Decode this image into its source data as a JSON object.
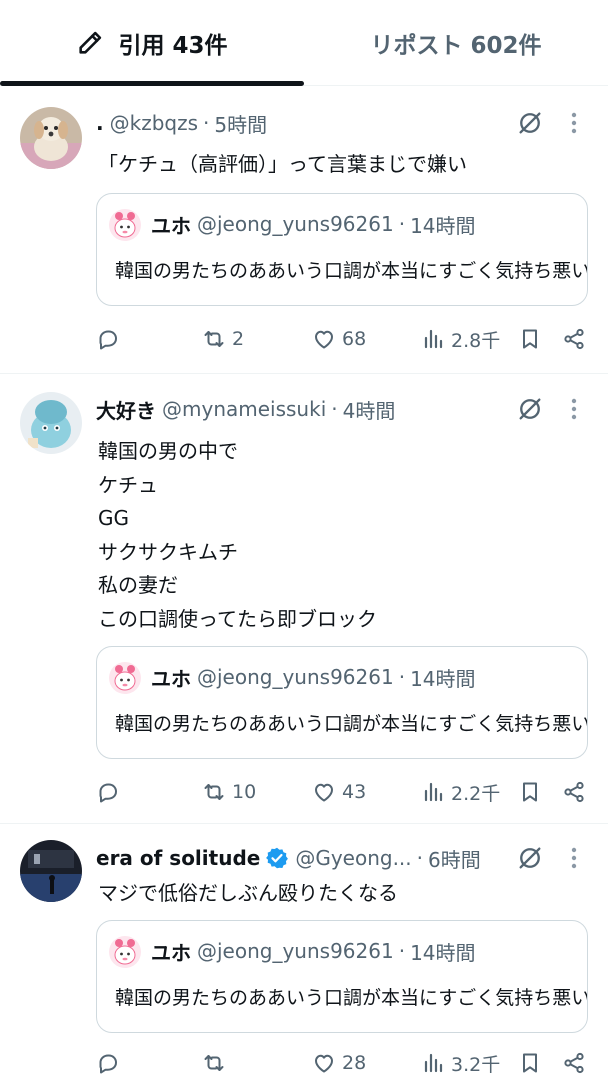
{
  "tabs": {
    "quotes_label": "引用 43件",
    "reposts_label": "リポスト 602件"
  },
  "colors": {
    "text": "#0f1419",
    "secondary": "#536471",
    "border": "#cfd9de",
    "verified": "#1d9bf0"
  },
  "tweets": [
    {
      "display_name": ".",
      "handle": "@kzbqzs",
      "separator": "·",
      "time": "5時間",
      "lines": [
        "「ケチュ（高評価）」って言葉まじで嫌い"
      ],
      "quote": {
        "display_name": "ユホ",
        "handle": "@jeong_yuns96261",
        "separator": "·",
        "time": "14時間",
        "text": "韓国の男たちのああいう口調が本当にすごく気持ち悪い..."
      },
      "reply_count": "",
      "repost_count": "2",
      "like_count": "68",
      "view_count": "2.8千"
    },
    {
      "display_name": "大好き",
      "handle": "@mynameissuki",
      "separator": "·",
      "time": "4時間",
      "lines": [
        "韓国の男の中で",
        "ケチュ",
        "GG",
        "サクサクキムチ",
        "私の妻だ",
        "この口調使ってたら即ブロック"
      ],
      "quote": {
        "display_name": "ユホ",
        "handle": "@jeong_yuns96261",
        "separator": "·",
        "time": "14時間",
        "text": "韓国の男たちのああいう口調が本当にすごく気持ち悪い..."
      },
      "reply_count": "",
      "repost_count": "10",
      "like_count": "43",
      "view_count": "2.2千"
    },
    {
      "display_name": "era of solitude",
      "handle": "@Gyeong...",
      "separator": "·",
      "time": "6時間",
      "verified": true,
      "lines": [
        "マジで低俗だしぶん殴りたくなる"
      ],
      "quote": {
        "display_name": "ユホ",
        "handle": "@jeong_yuns96261",
        "separator": "·",
        "time": "14時間",
        "text": "韓国の男たちのああいう口調が本当にすごく気持ち悪い..."
      },
      "reply_count": "",
      "repost_count": "",
      "like_count": "28",
      "view_count": "3.2千"
    }
  ],
  "icons": {
    "tab": "pencil-icon",
    "grok": "grok-icon",
    "more": "more-vertical-icon",
    "reply": "reply-icon",
    "repost": "repost-icon",
    "like": "heart-icon",
    "views": "views-icon",
    "bookmark": "bookmark-icon",
    "share": "share-icon",
    "verified": "verified-badge-icon"
  }
}
